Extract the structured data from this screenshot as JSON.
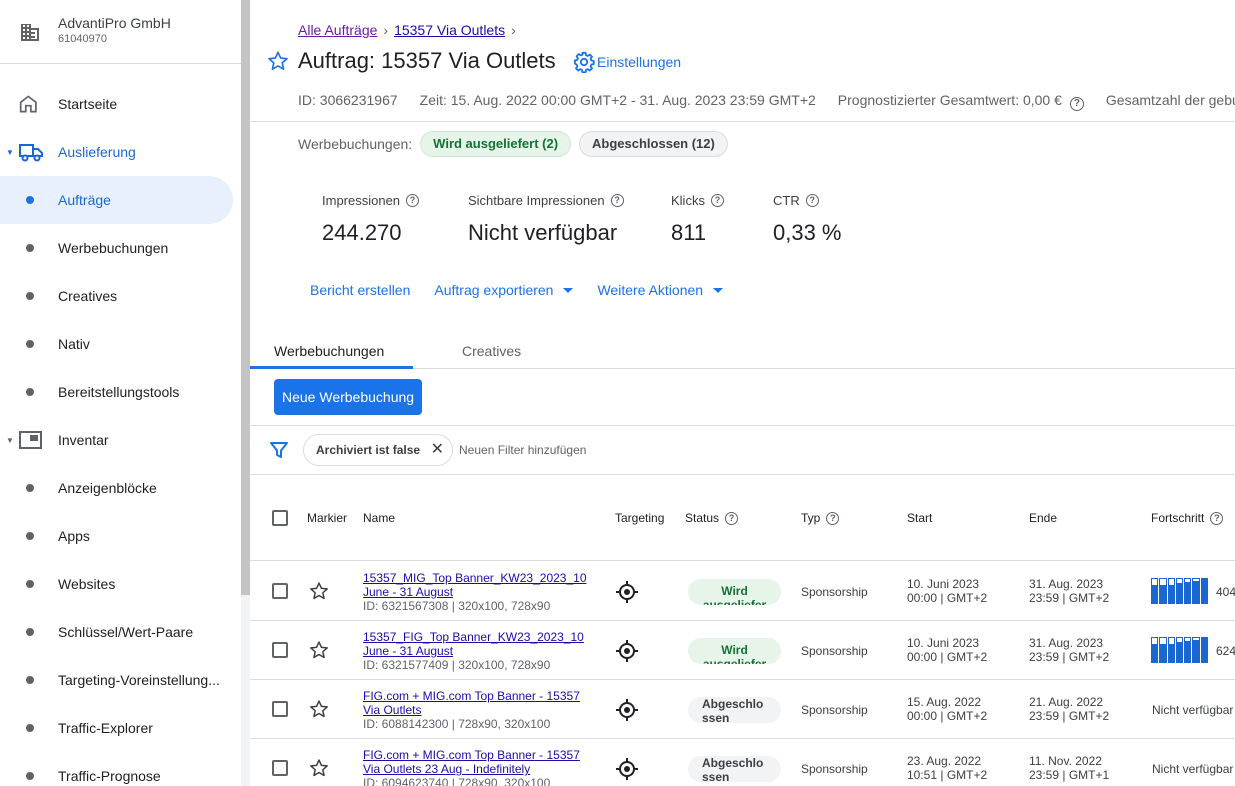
{
  "account": {
    "name": "AdvantiPro GmbH",
    "id": "61040970"
  },
  "sidebar": {
    "items": [
      {
        "label": "Startseite"
      },
      {
        "label": "Auslieferung"
      },
      {
        "label": "Aufträge"
      },
      {
        "label": "Werbebuchungen"
      },
      {
        "label": "Creatives"
      },
      {
        "label": "Nativ"
      },
      {
        "label": "Bereitstellungstools"
      },
      {
        "label": "Inventar"
      },
      {
        "label": "Anzeigenblöcke"
      },
      {
        "label": "Apps"
      },
      {
        "label": "Websites"
      },
      {
        "label": "Schlüssel/Wert-Paare"
      },
      {
        "label": "Targeting-Voreinstellung..."
      },
      {
        "label": "Traffic-Explorer"
      },
      {
        "label": "Traffic-Prognose"
      }
    ]
  },
  "breadcrumb": {
    "first": "Alle Aufträge",
    "second": "15357 Via Outlets"
  },
  "header": {
    "title": "Auftrag: 15357 Via Outlets",
    "settings": "Einstellungen",
    "id": "ID: 3066231967",
    "time": "Zeit: 15. Aug. 2022 00:00 GMT+2 - 31. Aug. 2023 23:59 GMT+2",
    "forecast": "Prognostizierter Gesamtwert: 0,00 €",
    "total": "Gesamtzahl der gebu"
  },
  "lineitems": {
    "label": "Werbebuchungen:",
    "delivering": "Wird ausgeliefert (2)",
    "completed": "Abgeschlossen (12)"
  },
  "stats": [
    {
      "label": "Impressionen",
      "value": "244.270"
    },
    {
      "label": "Sichtbare Impressionen",
      "value": "Nicht verfügbar"
    },
    {
      "label": "Klicks",
      "value": "811"
    },
    {
      "label": "CTR",
      "value": "0,33 %"
    }
  ],
  "actions": {
    "report": "Bericht erstellen",
    "export": "Auftrag exportieren",
    "more": "Weitere Aktionen"
  },
  "tabs": {
    "lineitems": "Werbebuchungen",
    "creatives": "Creatives"
  },
  "new_button": "Neue Werbebuchung",
  "filter": {
    "chip": "Archiviert ist false",
    "add": "Neuen Filter hinzufügen"
  },
  "table": {
    "headers": {
      "mark": "Markier",
      "name": "Name",
      "targeting": "Targeting",
      "status": "Status",
      "type": "Typ",
      "start": "Start",
      "end": "Ende",
      "progress": "Fortschritt"
    },
    "rows": [
      {
        "name1": "15357_MIG_Top Banner_KW23_2023_10",
        "name2": "June - 31 August",
        "id": "ID: 6321567308 | 320x100, 728x90",
        "status": "Wird ausgeliefer",
        "type": "Sponsorship",
        "start1": "10. Juni 2023",
        "start2": "00:00 | GMT+2",
        "end1": "31. Aug. 2023",
        "end2": "23:59 | GMT+2",
        "progress": "404"
      },
      {
        "name1": "15357_FIG_Top Banner_KW23_2023_10",
        "name2": "June - 31 August",
        "id": "ID: 6321577409 | 320x100, 728x90",
        "status": "Wird ausgeliefer",
        "type": "Sponsorship",
        "start1": "10. Juni 2023",
        "start2": "00:00 | GMT+2",
        "end1": "31. Aug. 2023",
        "end2": "23:59 | GMT+2",
        "progress": "624"
      },
      {
        "name1": "FIG.com + MIG.com Top Banner - 15357",
        "name2": "Via Outlets",
        "id": "ID: 6088142300 | 728x90, 320x100",
        "status1": "Abgeschlo",
        "status2": "ssen",
        "type": "Sponsorship",
        "start1": "15. Aug. 2022",
        "start2": "00:00 | GMT+2",
        "end1": "21. Aug. 2022",
        "end2": "23:59 | GMT+2",
        "progress": "Nicht verfügbar"
      },
      {
        "name1": "FIG.com + MIG.com Top Banner - 15357",
        "name2": "Via Outlets 23 Aug - Indefinitely",
        "id": "ID: 6094623740 | 728x90, 320x100",
        "status1": "Abgeschlo",
        "status2": "ssen",
        "type": "Sponsorship",
        "start1": "23. Aug. 2022",
        "start2": "10:51 | GMT+2",
        "end1": "11. Nov. 2022",
        "end2": "23:59 | GMT+1",
        "progress": "Nicht verfügbar"
      }
    ]
  }
}
